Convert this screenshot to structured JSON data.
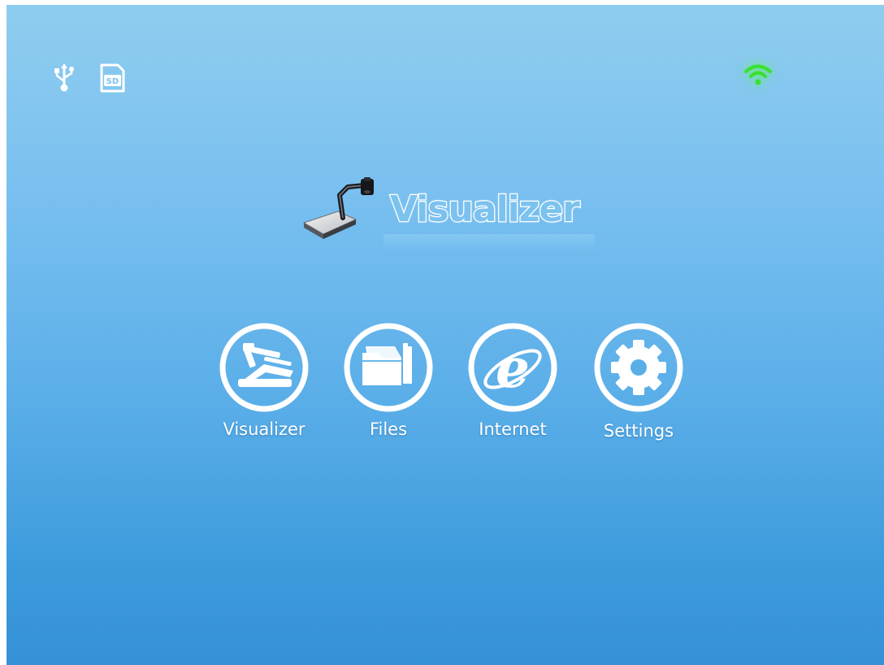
{
  "status_bar": {
    "usb_icon": "usb-icon",
    "sd_icon": "sd-card-icon",
    "sd_label": "SD",
    "wifi_icon": "wifi-icon",
    "wifi_color": "#3be030"
  },
  "brand": {
    "device_icon": "document-camera-icon",
    "title": "Visualizer"
  },
  "apps": [
    {
      "icon": "document-camera-icon",
      "label": "Visualizer"
    },
    {
      "icon": "folder-icon",
      "label": "Files"
    },
    {
      "icon": "internet-explorer-icon",
      "label": "Internet"
    },
    {
      "icon": "gear-icon",
      "label": "Settings"
    }
  ],
  "colors": {
    "background_top": "#8fcdee",
    "background_bottom": "#3691d6",
    "icon_white": "#ffffff"
  }
}
